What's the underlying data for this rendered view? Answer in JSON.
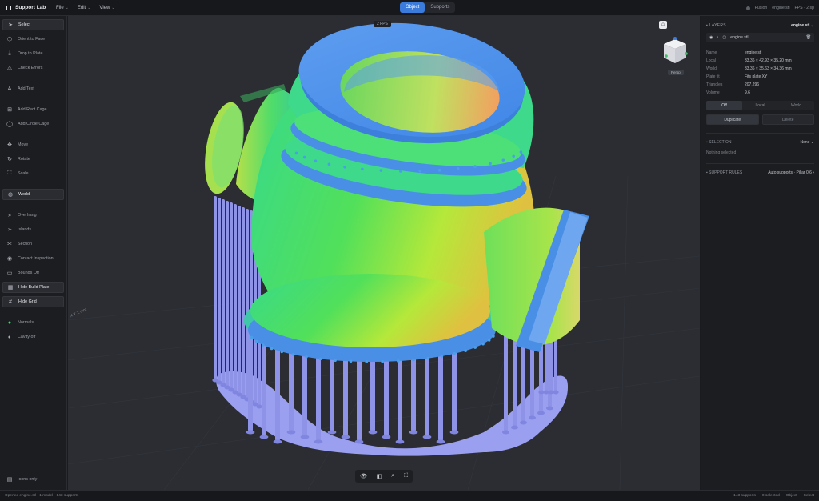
{
  "app": {
    "name": "Support Lab",
    "menu": [
      "File",
      "Edit",
      "View"
    ]
  },
  "mode": {
    "tabs": [
      "Object",
      "Supports"
    ],
    "active": 0
  },
  "topright": {
    "items": [
      "Fusion",
      "engine.stl",
      "FPS · 2 sp"
    ]
  },
  "sidebar": {
    "groups": [
      [
        {
          "label": "Select",
          "icon": "pointer-icon",
          "active": true
        },
        {
          "label": "Orient to Face",
          "icon": "cube-icon"
        },
        {
          "label": "Drop to Plate",
          "icon": "drop-icon"
        },
        {
          "label": "Check Errors",
          "icon": "warning-icon"
        }
      ],
      [
        {
          "label": "Add Text",
          "icon": "text-icon"
        }
      ],
      [
        {
          "label": "Add Rect Cage",
          "icon": "square-icon"
        },
        {
          "label": "Add Circle Cage",
          "icon": "circle-icon"
        }
      ],
      [
        {
          "label": "Move",
          "icon": "move-icon"
        },
        {
          "label": "Rotate",
          "icon": "rotate-icon"
        },
        {
          "label": "Scale",
          "icon": "scale-icon"
        }
      ],
      [
        {
          "label": "World",
          "icon": "globe-icon",
          "active": true
        }
      ],
      [
        {
          "label": "Overhang",
          "icon": "chevrons-icon"
        },
        {
          "label": "Islands",
          "icon": "send-icon"
        },
        {
          "label": "Section",
          "icon": "scissors-icon"
        },
        {
          "label": "Contact Inspection",
          "icon": "eye-icon"
        },
        {
          "label": "Bounds Off",
          "icon": "bounds-icon"
        },
        {
          "label": "Hide Build Plate",
          "icon": "plate-icon",
          "active": true
        },
        {
          "label": "Hide Grid",
          "icon": "grid-icon",
          "active": true
        }
      ],
      [
        {
          "label": "Normals",
          "icon": "normals-icon"
        },
        {
          "label": "Cavity off",
          "icon": "contrast-icon"
        }
      ]
    ],
    "bottom": {
      "label": "Icons only",
      "icon": "sidebar-icon"
    }
  },
  "viewport": {
    "fps": "2 FPS",
    "cube_label": "Persp",
    "axis_label": "X Y Z mm",
    "toolbar": [
      "eye-icon",
      "layers-icon",
      "zoom-icon",
      "fit-icon"
    ]
  },
  "panel": {
    "layers_title": "LAYERS",
    "layers_value": "engine.stl",
    "file": "engine.stl",
    "props": [
      {
        "k": "Name",
        "v": "engine.stl"
      },
      {
        "k": "Local",
        "v": "33.36 × 42.93 × 35.20 mm"
      },
      {
        "k": "World",
        "v": "33.36 × 35.63 × 34.36 mm"
      },
      {
        "k": "Plate fit",
        "v": "Fits plate XY"
      },
      {
        "k": "Triangles",
        "v": "207,296"
      },
      {
        "k": "Volume",
        "v": "9.6"
      }
    ],
    "space_tabs": [
      "Off",
      "Local",
      "World"
    ],
    "space_active": 0,
    "buttons": [
      "Duplicate",
      "Delete"
    ],
    "sel_title": "SELECTION",
    "sel_value": "None",
    "sel_note": "Nothing selected",
    "rules_title": "SUPPORT RULES",
    "rules_value": "Auto supports · Pillar 0.6"
  },
  "status": {
    "left": "Opened engine.stl · 1 model · 143 supports",
    "right": [
      "143 supports",
      "0 selected",
      "Object",
      "Select"
    ]
  },
  "colors": {
    "accent": "#3a7bdc",
    "support": "#8f93e8",
    "raft": "#9a9ff0"
  }
}
